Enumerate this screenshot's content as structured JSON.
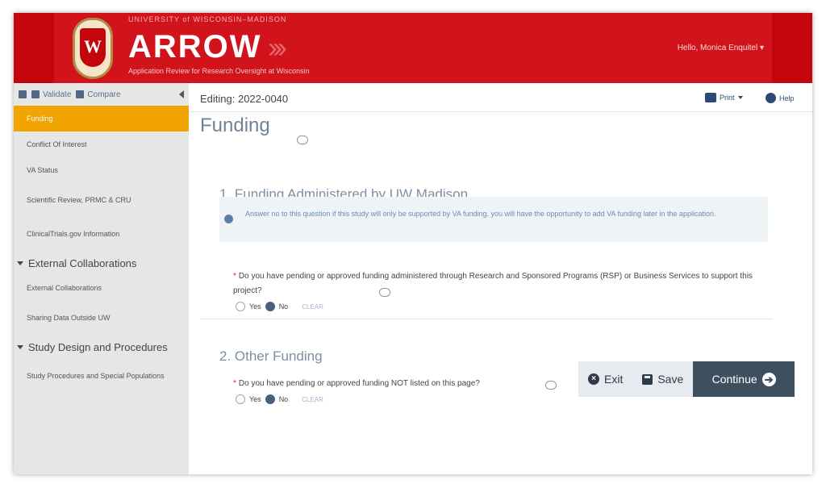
{
  "header": {
    "university": "UNIVERSITY of WISCONSIN–MADISON",
    "crest_letter": "W",
    "app_name": "ARROW",
    "subtitle": "Application Review for Research Oversight at Wisconsin",
    "greeting": "Hello, Monica Enquitel ▾"
  },
  "sidebar": {
    "tools": {
      "validate": "Validate",
      "compare": "Compare"
    },
    "items": [
      {
        "label": "Funding",
        "active": true
      },
      {
        "label": "Conflict Of Interest"
      },
      {
        "label": "VA Status"
      },
      {
        "label": "Scientific Review, PRMC & CRU"
      },
      {
        "label": "ClinicalTrials.gov Information"
      }
    ],
    "sections": [
      {
        "title": "External Collaborations",
        "items": [
          "External Collaborations",
          "Sharing Data Outside UW"
        ]
      },
      {
        "title": "Study Design and Procedures",
        "items": [
          "Study Procedures and Special Populations"
        ]
      }
    ]
  },
  "topbar": {
    "editing": "Editing: 2022-0040",
    "print": "Print",
    "help": "Help"
  },
  "page": {
    "title": "Funding",
    "section1": {
      "title": "1. Funding Administered by UW Madison",
      "info": "Answer no to this question if this study will only be supported by VA funding, you will have the opportunity to add VA funding later in the application.",
      "question": "Do you have pending or approved funding administered through Research and Sponsored Programs (RSP) or Business Services to support this project?",
      "yes": "Yes",
      "no": "No",
      "clear": "CLEAR"
    },
    "section2": {
      "title": "2. Other Funding",
      "question": "Do you have pending or approved funding NOT listed on this page?",
      "yes": "Yes",
      "no": "No",
      "clear": "CLEAR"
    }
  },
  "actions": {
    "exit": "Exit",
    "save": "Save",
    "continue": "Continue"
  },
  "colors": {
    "brand_red": "#c5050c",
    "active_nav": "#f2a400",
    "continue_bg": "#3e4f60"
  }
}
